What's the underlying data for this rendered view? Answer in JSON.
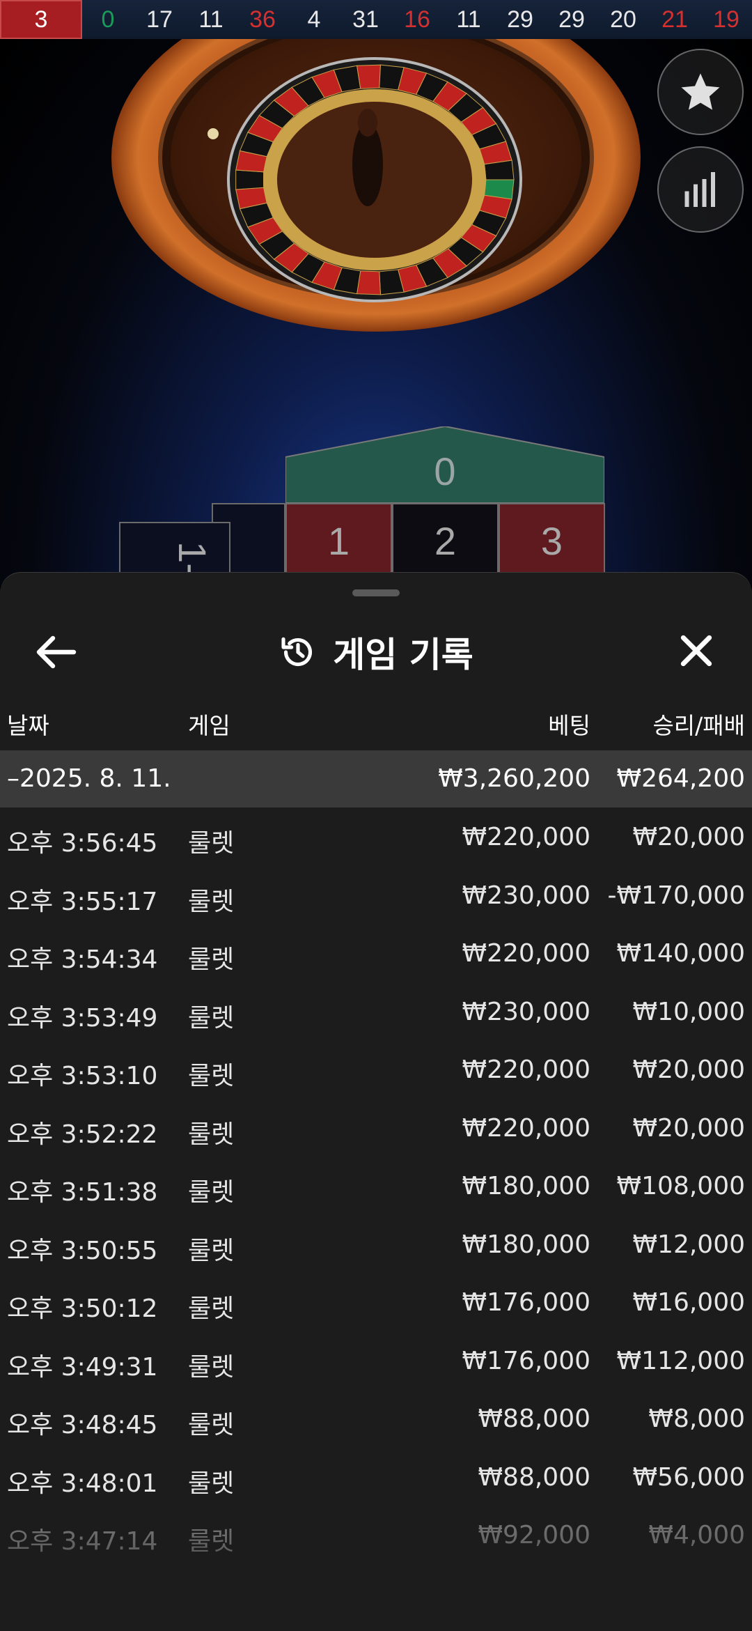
{
  "results_strip": {
    "current": "3",
    "history": [
      {
        "n": "0",
        "c": "green"
      },
      {
        "n": "17",
        "c": "black"
      },
      {
        "n": "11",
        "c": "black"
      },
      {
        "n": "36",
        "c": "red"
      },
      {
        "n": "4",
        "c": "black"
      },
      {
        "n": "31",
        "c": "black"
      },
      {
        "n": "16",
        "c": "red"
      },
      {
        "n": "11",
        "c": "black"
      },
      {
        "n": "29",
        "c": "black"
      },
      {
        "n": "29",
        "c": "black"
      },
      {
        "n": "20",
        "c": "black"
      },
      {
        "n": "21",
        "c": "red"
      },
      {
        "n": "19",
        "c": "red"
      }
    ]
  },
  "board": {
    "zero": "0",
    "side_label": "1-",
    "numbers": [
      "1",
      "2",
      "3"
    ]
  },
  "buttons": {
    "favorite_icon": "star-icon",
    "stats_icon": "bar-chart-icon"
  },
  "sheet": {
    "title": "게임 기록",
    "columns": {
      "date": "날짜",
      "game": "게임",
      "bet": "베팅",
      "win": "승리/패배"
    },
    "date_group": {
      "label": "–2025. 8. 11.",
      "bet_total": "₩3,260,200",
      "win_total": "₩264,200"
    },
    "rows": [
      {
        "time": "오후 3:56:45",
        "game": "룰렛",
        "bet": "₩220,000",
        "win": "₩20,000"
      },
      {
        "time": "오후 3:55:17",
        "game": "룰렛",
        "bet": "₩230,000",
        "win": "-₩170,000"
      },
      {
        "time": "오후 3:54:34",
        "game": "룰렛",
        "bet": "₩220,000",
        "win": "₩140,000"
      },
      {
        "time": "오후 3:53:49",
        "game": "룰렛",
        "bet": "₩230,000",
        "win": "₩10,000"
      },
      {
        "time": "오후 3:53:10",
        "game": "룰렛",
        "bet": "₩220,000",
        "win": "₩20,000"
      },
      {
        "time": "오후 3:52:22",
        "game": "룰렛",
        "bet": "₩220,000",
        "win": "₩20,000"
      },
      {
        "time": "오후 3:51:38",
        "game": "룰렛",
        "bet": "₩180,000",
        "win": "₩108,000"
      },
      {
        "time": "오후 3:50:55",
        "game": "룰렛",
        "bet": "₩180,000",
        "win": "₩12,000"
      },
      {
        "time": "오후 3:50:12",
        "game": "룰렛",
        "bet": "₩176,000",
        "win": "₩16,000"
      },
      {
        "time": "오후 3:49:31",
        "game": "룰렛",
        "bet": "₩176,000",
        "win": "₩112,000"
      },
      {
        "time": "오후 3:48:45",
        "game": "룰렛",
        "bet": "₩88,000",
        "win": "₩8,000"
      },
      {
        "time": "오후 3:48:01",
        "game": "룰렛",
        "bet": "₩88,000",
        "win": "₩56,000"
      },
      {
        "time": "오후 3:47:14",
        "game": "룰렛",
        "bet": "₩92,000",
        "win": "₩4,000"
      }
    ]
  },
  "colors": {
    "red": "#d4302f",
    "green": "#1b9b5a",
    "sheet_bg": "#1c1c1c",
    "date_row_bg": "#3a3a3a"
  }
}
